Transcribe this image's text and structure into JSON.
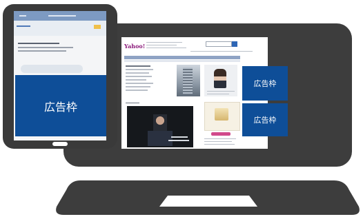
{
  "ad_slots": {
    "tablet_ad_label": "広告枠",
    "monitor_ad_top_label": "広告枠",
    "monitor_ad_bottom_label": "広告枠"
  },
  "webpage": {
    "logo_text": "Yahoo!"
  },
  "colors": {
    "device_frame": "#3d3d3d",
    "ad_background": "#0e4e98",
    "ad_text": "#ffffff"
  }
}
